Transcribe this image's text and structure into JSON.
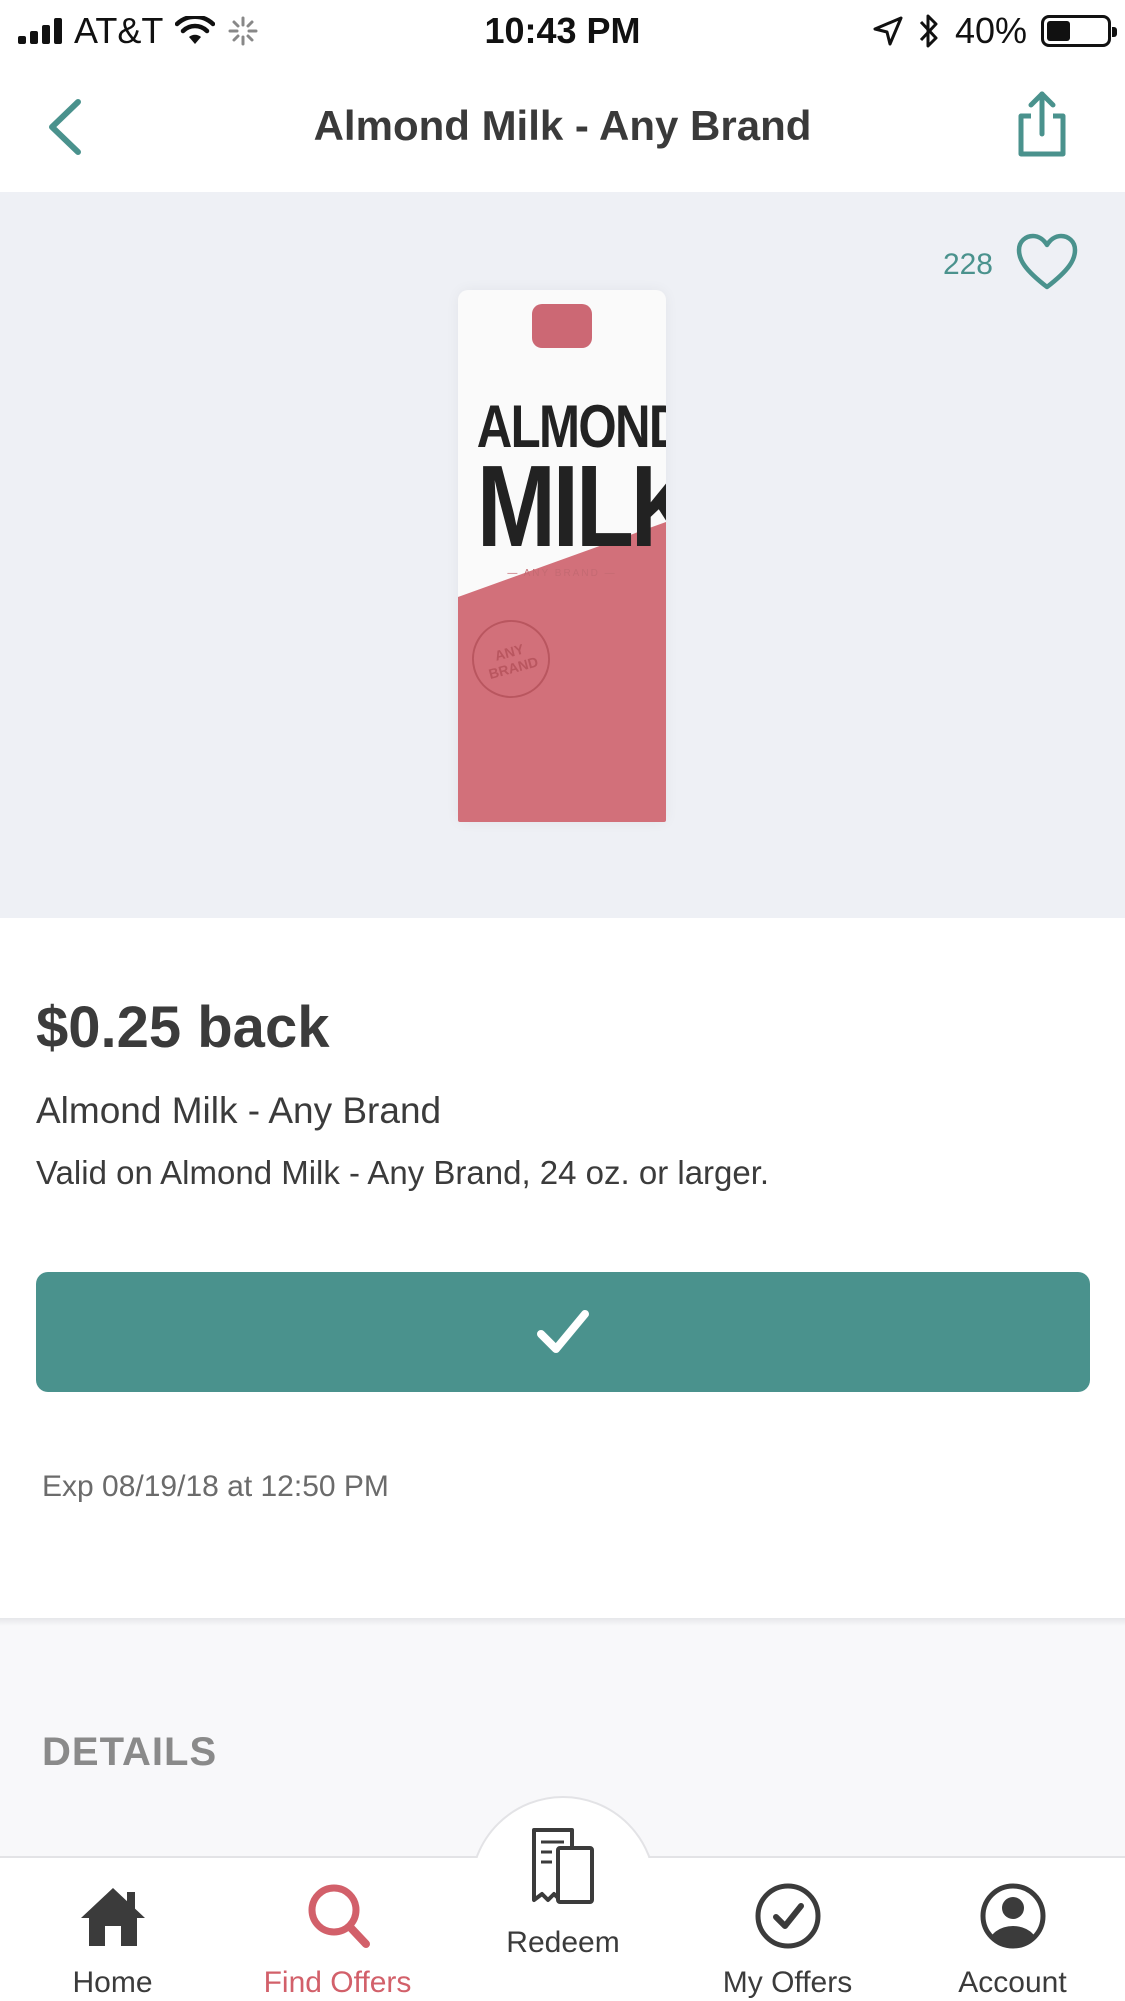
{
  "status_bar": {
    "carrier": "AT&T",
    "time": "10:43 PM",
    "battery": "40%",
    "battery_level": 0.4
  },
  "nav": {
    "title": "Almond Milk - Any Brand",
    "back_icon": "chevron-left-icon",
    "share_icon": "share-icon"
  },
  "hero": {
    "like_count": "228",
    "heart_icon": "heart-icon",
    "carton": {
      "word1": "ALMOND",
      "word2": "MILK",
      "sub": "— ANY BRAND —",
      "seal": "ANY BRAND"
    }
  },
  "offer": {
    "amount": "$0.25 back",
    "name": "Almond Milk - Any Brand",
    "description": "Valid on Almond Milk - Any Brand, 24 oz. or larger.",
    "expiration": "Exp 08/19/18 at 12:50 PM"
  },
  "details": {
    "heading": "DETAILS"
  },
  "colors": {
    "accent": "#4a928d",
    "active_tab": "#d2606a",
    "hero_bg": "#eef0f5"
  },
  "tabs": [
    {
      "label": "Home",
      "icon": "home-icon",
      "active": false
    },
    {
      "label": "Find Offers",
      "icon": "search-icon",
      "active": true
    },
    {
      "label": "Redeem",
      "icon": "receipt-icon",
      "active": false
    },
    {
      "label": "My Offers",
      "icon": "check-circle-icon",
      "active": false
    },
    {
      "label": "Account",
      "icon": "user-circle-icon",
      "active": false
    }
  ]
}
